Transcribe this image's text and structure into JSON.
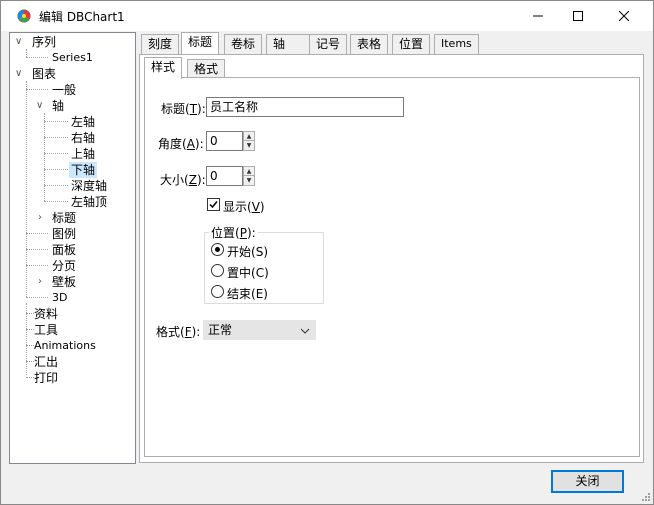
{
  "window": {
    "title": "编辑 DBChart1",
    "icons": {
      "app": "chart-icon",
      "minimize": "minimize-icon",
      "maximize": "maximize-icon",
      "close": "close-icon"
    }
  },
  "tree": {
    "items": [
      {
        "label": "序列",
        "expanded": true
      },
      {
        "label": "Series1"
      },
      {
        "label": "图表",
        "expanded": true
      },
      {
        "label": "一般"
      },
      {
        "label": "轴",
        "expanded": true
      },
      {
        "label": "左轴"
      },
      {
        "label": "右轴"
      },
      {
        "label": "上轴"
      },
      {
        "label": "下轴",
        "selected": true
      },
      {
        "label": "深度轴"
      },
      {
        "label": "左轴顶"
      },
      {
        "label": "标题",
        "expanded": false
      },
      {
        "label": "图例"
      },
      {
        "label": "面板"
      },
      {
        "label": "分页"
      },
      {
        "label": "壁板",
        "expanded": false
      },
      {
        "label": "3D"
      },
      {
        "label": "资料"
      },
      {
        "label": "工具"
      },
      {
        "label": "Animations"
      },
      {
        "label": "汇出"
      },
      {
        "label": "打印"
      }
    ]
  },
  "tabs": [
    {
      "label": "刻度"
    },
    {
      "label": "标题",
      "active": true
    },
    {
      "label": "卷标"
    },
    {
      "label": "轴"
    },
    {
      "label": "记号"
    },
    {
      "label": "表格"
    },
    {
      "label": "位置"
    },
    {
      "label": "Items"
    }
  ],
  "subtabs": [
    {
      "label": "样式",
      "active": true
    },
    {
      "label": "格式"
    }
  ],
  "form": {
    "title_label": "标题",
    "title_key": "T",
    "title_value": "员工名称",
    "angle_label": "角度",
    "angle_key": "A",
    "angle_value": "0",
    "size_label": "大小",
    "size_key": "Z",
    "size_value": "0",
    "show_label": "显示",
    "show_key": "V",
    "show_checked": true,
    "position_group": "位置",
    "position_key": "P",
    "position_options": [
      {
        "label": "开始",
        "key": "S",
        "selected": true
      },
      {
        "label": "置中",
        "key": "C",
        "selected": false
      },
      {
        "label": "结束",
        "key": "E",
        "selected": false
      }
    ],
    "format_label": "格式",
    "format_key": "F",
    "format_value": "正常"
  },
  "footer": {
    "close_label": "关闭"
  },
  "colors": {
    "accent": "#0078d7",
    "selection": "#cce8ff",
    "tree_line": "#a0a0a0"
  }
}
